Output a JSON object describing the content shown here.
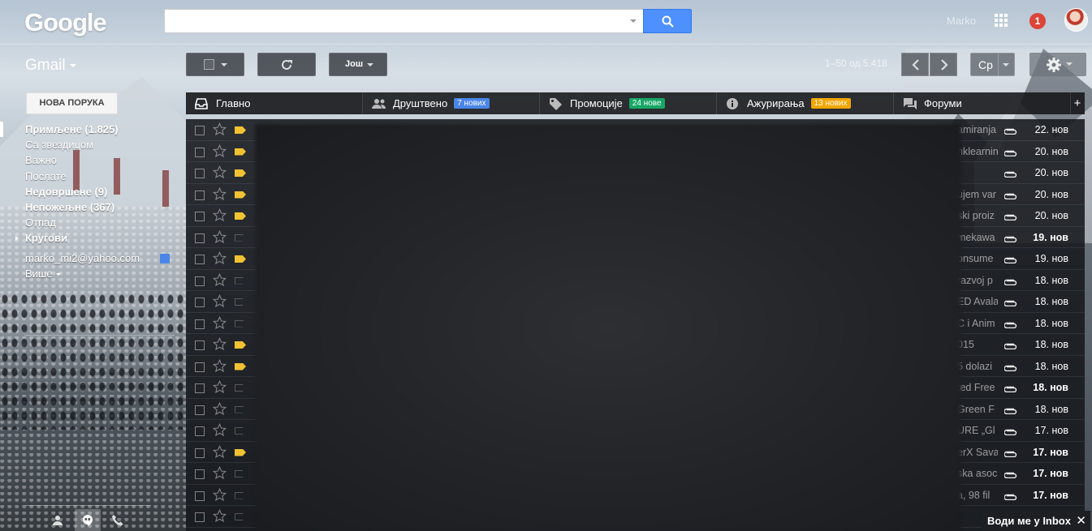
{
  "header": {
    "logo": "Google",
    "search": {
      "value": "",
      "placeholder": ""
    },
    "user_name": "Marko",
    "notification_count": "1"
  },
  "toolbar": {
    "app_label": "Gmail",
    "more_label": "Још",
    "pagination": "1–50 од 5.418",
    "language": "Ср"
  },
  "compose_label": "НОВА ПОРУКА",
  "sidebar": {
    "items": [
      {
        "label": "Примљене (1.825)",
        "bold": true,
        "active": true
      },
      {
        "label": "Са звездицом",
        "bold": false
      },
      {
        "label": "Важно",
        "bold": false
      },
      {
        "label": "Послате",
        "bold": false
      },
      {
        "label": "Недовршене (9)",
        "bold": true
      },
      {
        "label": "Непожељне (367)",
        "bold": true
      },
      {
        "label": "Отпад",
        "bold": false
      },
      {
        "label": "Кругови",
        "bold": true
      },
      {
        "label": "marko_mi2@yahoo.com",
        "bold": false
      },
      {
        "label": "Више",
        "bold": false
      }
    ]
  },
  "tabs": [
    {
      "label": "Главно",
      "badge": "",
      "badge_color": ""
    },
    {
      "label": "Друштвено",
      "badge": "7 нових",
      "badge_color": "#4a86e8"
    },
    {
      "label": "Промоције",
      "badge": "24 нове",
      "badge_color": "#16a765"
    },
    {
      "label": "Ажурирања",
      "badge": "13 нових",
      "badge_color": "#f2a600"
    },
    {
      "label": "Форуми",
      "badge": "",
      "badge_color": ""
    }
  ],
  "emails": [
    {
      "subject": "amiranja",
      "date": "22. нов",
      "unread": false,
      "important": true
    },
    {
      "subject": "nklearnin",
      "date": "20. нов",
      "unread": false,
      "important": true
    },
    {
      "subject": "",
      "date": "20. нов",
      "unread": false,
      "important": true
    },
    {
      "subject": "ujem var",
      "date": "20. нов",
      "unread": false,
      "important": true
    },
    {
      "subject": "ski proiz",
      "date": "20. нов",
      "unread": false,
      "important": true
    },
    {
      "subject": "mekawa",
      "date": "19. нов",
      "unread": true,
      "important": false
    },
    {
      "subject": "onsume",
      "date": "19. нов",
      "unread": false,
      "important": true
    },
    {
      "subject": "razvoj p",
      "date": "18. нов",
      "unread": false,
      "important": false
    },
    {
      "subject": "ED Avala",
      "date": "18. нов",
      "unread": false,
      "important": false
    },
    {
      "subject": "C i Anim",
      "date": "18. нов",
      "unread": false,
      "important": false
    },
    {
      "subject": "015",
      "date": "18. нов",
      "unread": false,
      "important": true
    },
    {
      "subject": "5 dolazi",
      "date": "18. нов",
      "unread": false,
      "important": true
    },
    {
      "subject": "ted Free",
      "date": "18. нов",
      "unread": true,
      "important": false
    },
    {
      "subject": "Green F",
      "date": "18. нов",
      "unread": false,
      "important": false
    },
    {
      "subject": "URE „Gl",
      "date": "17. нов",
      "unread": false,
      "important": false
    },
    {
      "subject": "erX Sava",
      "date": "17. нов",
      "unread": true,
      "important": true
    },
    {
      "subject": "ska asoc",
      "date": "17. нов",
      "unread": true,
      "important": false
    },
    {
      "subject": "a, 98 fil",
      "date": "17. нов",
      "unread": true,
      "important": false
    },
    {
      "subject": "",
      "date": "",
      "unread": false,
      "important": false
    }
  ],
  "inbox_promo": "Води ме у Inbox",
  "colors": {
    "search_button": "#4d90fe",
    "notification": "#db4437",
    "important_marker": "#f1c232"
  }
}
